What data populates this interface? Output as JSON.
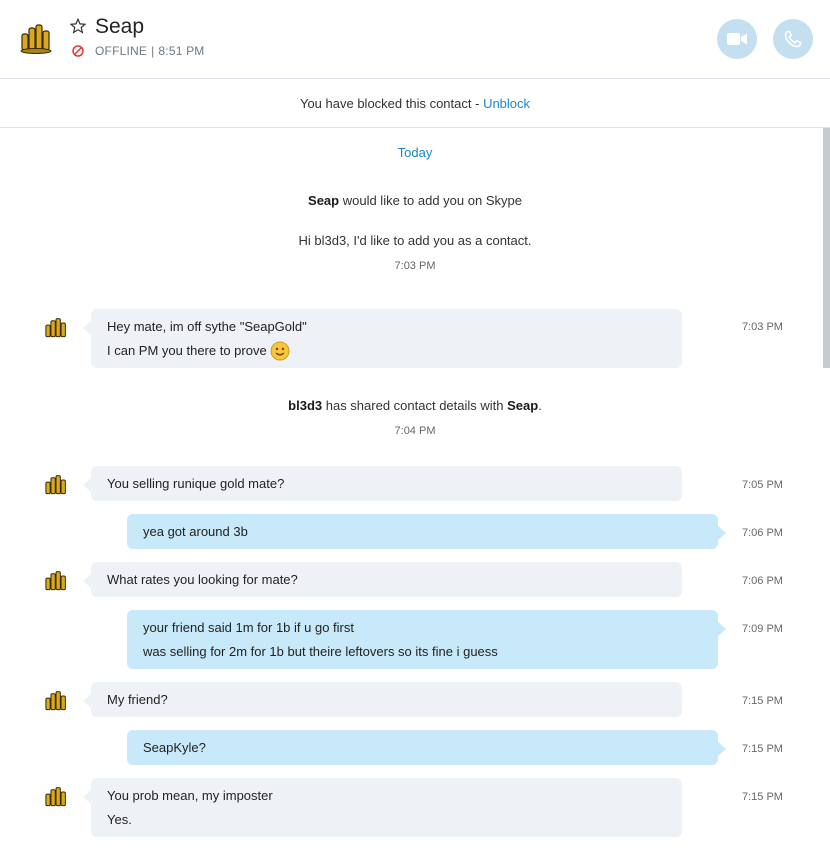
{
  "header": {
    "contact_name": "Seap",
    "status": "OFFLINE",
    "separator": "|",
    "last_seen": "8:51 PM",
    "star_icon": "star-icon",
    "status_icon": "offline-icon",
    "video_icon": "video-call-icon",
    "audio_icon": "phone-call-icon",
    "accent_color": "#c4dff0"
  },
  "banner": {
    "text": "You have blocked this contact - ",
    "link": "Unblock"
  },
  "chat": {
    "date_divider": "Today",
    "add_request": {
      "name": "Seap",
      "text": " would like to add you on Skype",
      "greeting": "Hi bl3d3, I'd like to add you as a contact.",
      "time": "7:03 PM"
    },
    "shared_contact": {
      "from": "bl3d3",
      "text": " has shared contact details with ",
      "to": "Seap",
      "end": ".",
      "time": "7:04 PM"
    },
    "messages": [
      {
        "lines": [
          "Hey mate, im off sythe \"SeapGold\"",
          "I can PM you there to prove"
        ],
        "time": "7:03 PM",
        "direction": "incoming",
        "emoji": "smile-emoji"
      },
      {
        "lines": [
          "You selling runique gold mate?"
        ],
        "time": "7:05 PM",
        "direction": "incoming"
      },
      {
        "lines": [
          "yea got around 3b"
        ],
        "time": "7:06 PM",
        "direction": "outgoing"
      },
      {
        "lines": [
          "What rates you looking for mate?"
        ],
        "time": "7:06 PM",
        "direction": "incoming"
      },
      {
        "lines": [
          "your friend said 1m for 1b if u go first",
          "was selling for 2m for 1b but theire leftovers so its fine i guess"
        ],
        "time": "7:09 PM",
        "direction": "outgoing"
      },
      {
        "lines": [
          "My friend?"
        ],
        "time": "7:15 PM",
        "direction": "incoming"
      },
      {
        "lines": [
          "SeapKyle?"
        ],
        "time": "7:15 PM",
        "direction": "outgoing"
      },
      {
        "lines": [
          "You prob mean, my imposter",
          "Yes."
        ],
        "time": "7:15 PM",
        "direction": "incoming"
      }
    ]
  },
  "colors": {
    "incoming_bubble": "#eef1f5",
    "outgoing_bubble": "#c7e9f9",
    "link": "#1a86c8"
  }
}
